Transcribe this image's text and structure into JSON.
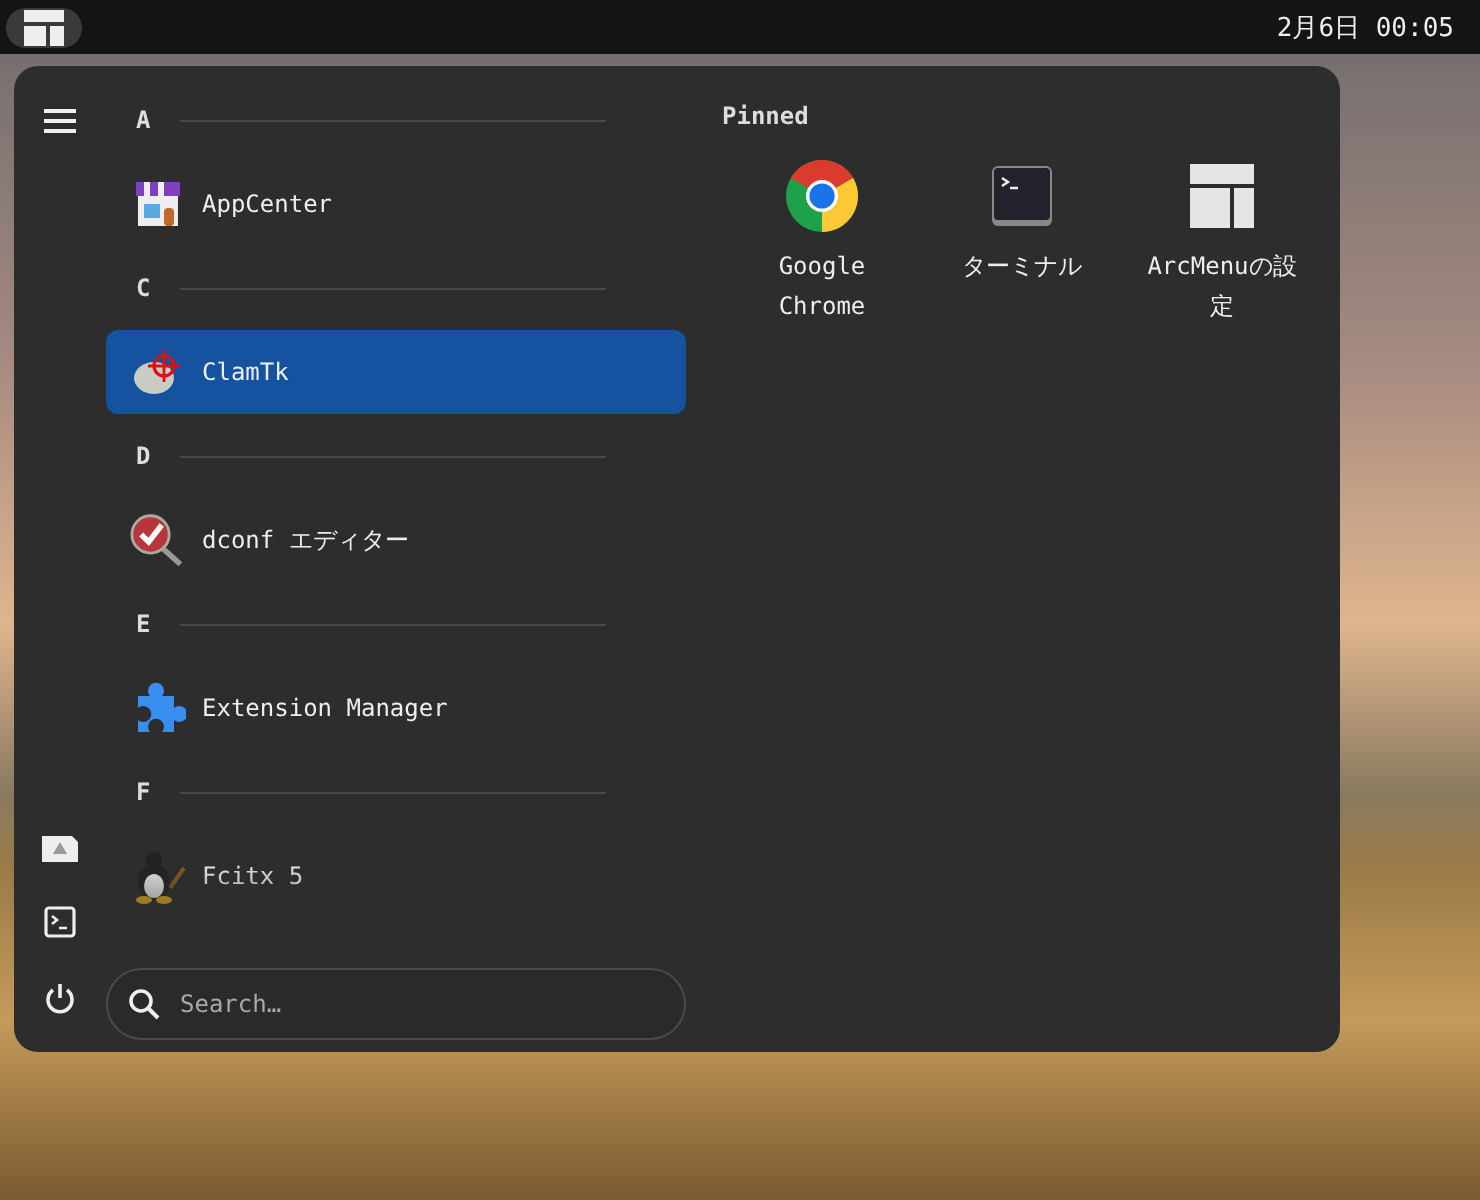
{
  "top_bar": {
    "clock": "2月6日 00:05"
  },
  "app_list": {
    "sections": [
      {
        "letter": "A",
        "apps": [
          {
            "name": "AppCenter",
            "selected": false
          }
        ]
      },
      {
        "letter": "C",
        "apps": [
          {
            "name": "ClamTk",
            "selected": true
          }
        ]
      },
      {
        "letter": "D",
        "apps": [
          {
            "name": "dconf エディター",
            "selected": false
          }
        ]
      },
      {
        "letter": "E",
        "apps": [
          {
            "name": "Extension Manager",
            "selected": false
          }
        ]
      },
      {
        "letter": "F",
        "apps": [
          {
            "name": "Fcitx 5",
            "selected": false
          }
        ]
      }
    ]
  },
  "search": {
    "placeholder": "Search…"
  },
  "pinned": {
    "title": "Pinned",
    "apps": [
      {
        "name": "Google Chrome"
      },
      {
        "name": "ターミナル"
      },
      {
        "name": "ArcMenuの設定"
      }
    ]
  }
}
